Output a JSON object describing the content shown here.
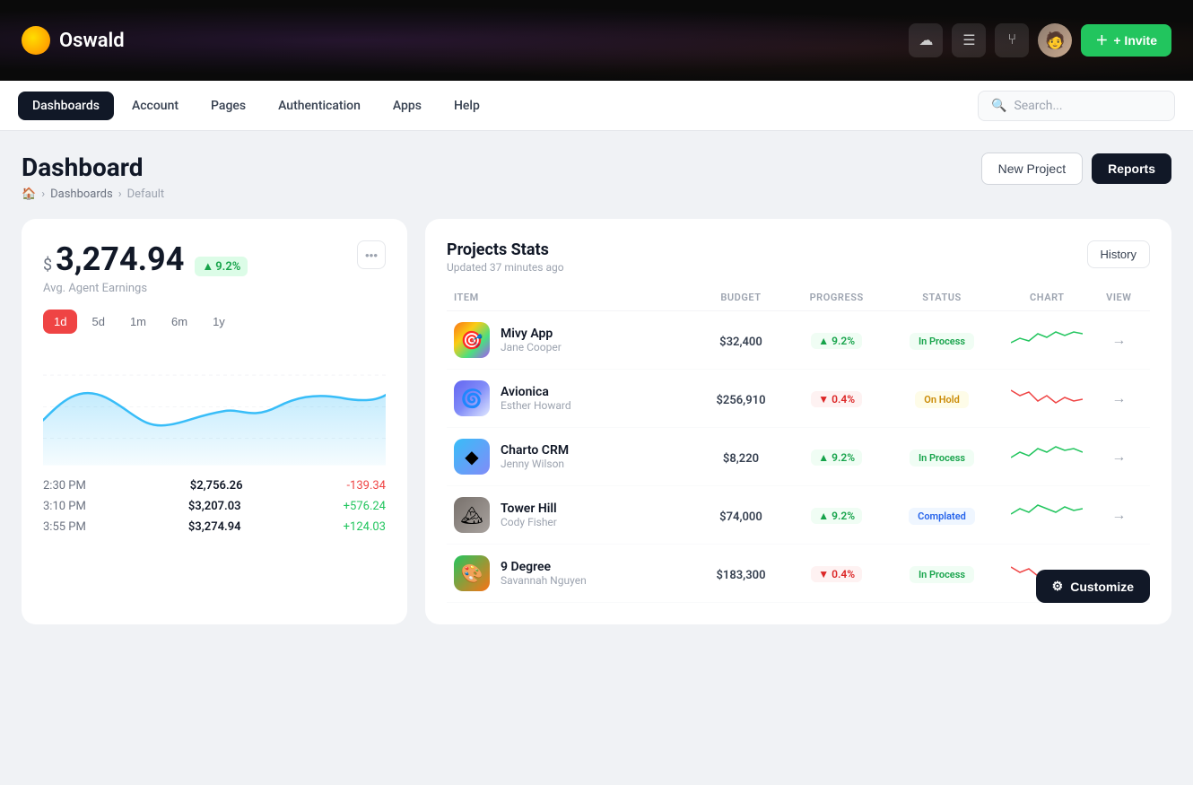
{
  "topBar": {
    "logoText": "Oswald",
    "inviteLabel": "+ Invite"
  },
  "navBar": {
    "items": [
      {
        "label": "Dashboards",
        "active": true
      },
      {
        "label": "Account",
        "active": false
      },
      {
        "label": "Pages",
        "active": false
      },
      {
        "label": "Authentication",
        "active": false
      },
      {
        "label": "Apps",
        "active": false
      },
      {
        "label": "Help",
        "active": false
      }
    ],
    "searchPlaceholder": "Search..."
  },
  "pageHeader": {
    "title": "Dashboard",
    "breadcrumb": [
      "Home",
      "Dashboards",
      "Default"
    ],
    "newProjectLabel": "New Project",
    "reportsLabel": "Reports"
  },
  "earningsCard": {
    "dollarSign": "$",
    "amount": "3,274.94",
    "badgeText": "9.2%",
    "label": "Avg. Agent Earnings",
    "timeFilters": [
      "1d",
      "5d",
      "1m",
      "6m",
      "1y"
    ],
    "activeFilter": "1d",
    "dataRows": [
      {
        "time": "2:30 PM",
        "value": "$2,756.26",
        "change": "-139.34",
        "type": "neg"
      },
      {
        "time": "3:10 PM",
        "value": "$3,207.03",
        "change": "+576.24",
        "type": "pos"
      },
      {
        "time": "3:55 PM",
        "value": "$3,274.94",
        "change": "+124.03",
        "type": "pos"
      }
    ]
  },
  "projectsCard": {
    "title": "Projects Stats",
    "subtitle": "Updated 37 minutes ago",
    "historyLabel": "History",
    "columns": [
      "ITEM",
      "BUDGET",
      "PROGRESS",
      "STATUS",
      "CHART",
      "VIEW"
    ],
    "projects": [
      {
        "name": "Mivy App",
        "subname": "Jane Cooper",
        "budget": "$32,400",
        "progress": "9.2%",
        "progressDir": "up",
        "status": "In Process",
        "statusType": "in-process",
        "iconType": "mivy",
        "iconEmoji": "🎯"
      },
      {
        "name": "Avionica",
        "subname": "Esther Howard",
        "budget": "$256,910",
        "progress": "0.4%",
        "progressDir": "down",
        "status": "On Hold",
        "statusType": "on-hold",
        "iconType": "avionica",
        "iconEmoji": "🌀"
      },
      {
        "name": "Charto CRM",
        "subname": "Jenny Wilson",
        "budget": "$8,220",
        "progress": "9.2%",
        "progressDir": "up",
        "status": "In Process",
        "statusType": "in-process",
        "iconType": "charto",
        "iconEmoji": "🔷"
      },
      {
        "name": "Tower Hill",
        "subname": "Cody Fisher",
        "budget": "$74,000",
        "progress": "9.2%",
        "progressDir": "up",
        "status": "Complated",
        "statusType": "completed",
        "iconType": "tower",
        "iconEmoji": "🏔️"
      },
      {
        "name": "9 Degree",
        "subname": "Savannah Nguyen",
        "budget": "$183,300",
        "progress": "0.4%",
        "progressDir": "down",
        "status": "In Process",
        "statusType": "in-process",
        "iconType": "nine",
        "iconEmoji": "🎨"
      }
    ],
    "customizeLabel": "Customize"
  }
}
